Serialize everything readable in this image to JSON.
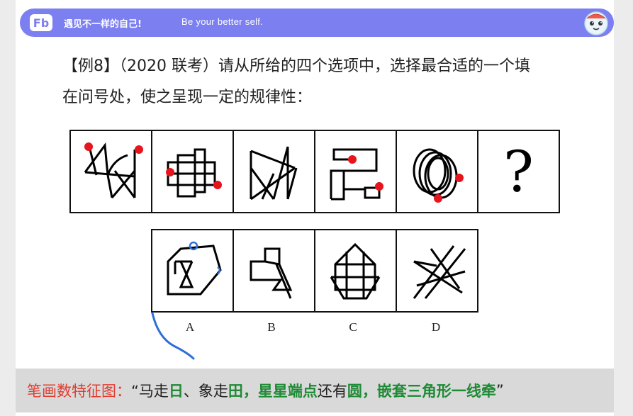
{
  "banner": {
    "logo": "Fb",
    "slogan_cn": "遇见不一样的自己!",
    "slogan_en": "Be your better self.",
    "mascot_icon": "mascot-icon"
  },
  "question": {
    "line1": "【例8】（2020 联考）请从所给的四个选项中，选择最合适的一个填",
    "line2": "在问号处，使之呈现一定的规律性："
  },
  "puzzle": {
    "question_mark": "?",
    "options": [
      "A",
      "B",
      "C",
      "D"
    ]
  },
  "footer": {
    "title": "笔画数特征图：",
    "quote_open": "“马走",
    "ri": "日",
    "sep1": "、象走",
    "tian": "田",
    "comma1": "，",
    "star": "星星端点",
    "mid": "还有",
    "circle": "圆",
    "tail": "，嵌套三角形一线牵",
    "quote_close": "”"
  },
  "colors": {
    "banner": "#7c7ff0",
    "dot": "#e8141c",
    "annotation": "#2f6fd8",
    "footer_title": "#e23b2e",
    "footer_green": "#1f8a36"
  }
}
